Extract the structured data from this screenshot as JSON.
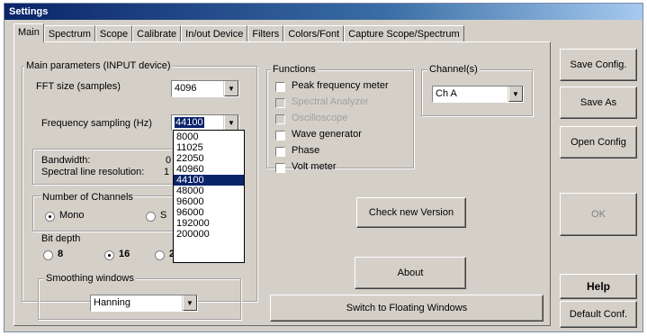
{
  "window": {
    "title": "Settings"
  },
  "tabs": [
    "Main",
    "Spectrum",
    "Scope",
    "Calibrate",
    "In/out Device",
    "Filters",
    "Colors/Font",
    "Capture Scope/Spectrum"
  ],
  "active_tab": "Main",
  "main_params": {
    "group_title": "Main parameters (INPUT device)",
    "fft_label": "FFT size (samples)",
    "fft_value": "4096",
    "freq_label": "Frequency sampling (Hz)",
    "freq_value": "44100",
    "freq_options": [
      "8000",
      "11025",
      "22050",
      "40960",
      "44100",
      "48000",
      "96000",
      "96000",
      "192000",
      "200000"
    ],
    "freq_highlighted": "44100"
  },
  "bandwidth": {
    "bandwidth_label": "Bandwidth:",
    "bandwidth_value": "0",
    "resolution_label": "Spectral line resolution:",
    "resolution_value": "1"
  },
  "channels": {
    "group_title": "Number of Channels",
    "options": [
      "Mono",
      "S"
    ],
    "selected": "Mono"
  },
  "bit_depth": {
    "group_title": "Bit depth",
    "options": [
      "8",
      "16",
      "2"
    ],
    "selected": "16"
  },
  "smoothing": {
    "group_title": "Smoothing windows",
    "value": "Hanning"
  },
  "functions": {
    "group_title": "Functions",
    "items": [
      {
        "label": "Peak frequency meter",
        "enabled": true
      },
      {
        "label": "Spectral Analyzer",
        "enabled": false
      },
      {
        "label": "Oscilloscope",
        "enabled": false
      },
      {
        "label": "Wave generator",
        "enabled": true
      },
      {
        "label": "Phase",
        "enabled": true
      },
      {
        "label": "Volt meter",
        "enabled": true
      }
    ]
  },
  "channels_sel": {
    "group_title": "Channel(s)",
    "value": "Ch A"
  },
  "buttons": {
    "check_version": "Check new Version",
    "about": "About",
    "floating": "Switch to Floating Windows",
    "save_config": "Save Config.",
    "save_as": "Save As",
    "open_config": "Open Config",
    "ok": "OK",
    "help": "Help",
    "default_conf": "Default Conf."
  },
  "colors": {
    "title_start": "#0a246a",
    "title_end": "#a6caf0",
    "face": "#d4d0c8",
    "selection": "#0a246a"
  },
  "icons": {
    "dropdown_arrow": "chevron-down-icon"
  }
}
